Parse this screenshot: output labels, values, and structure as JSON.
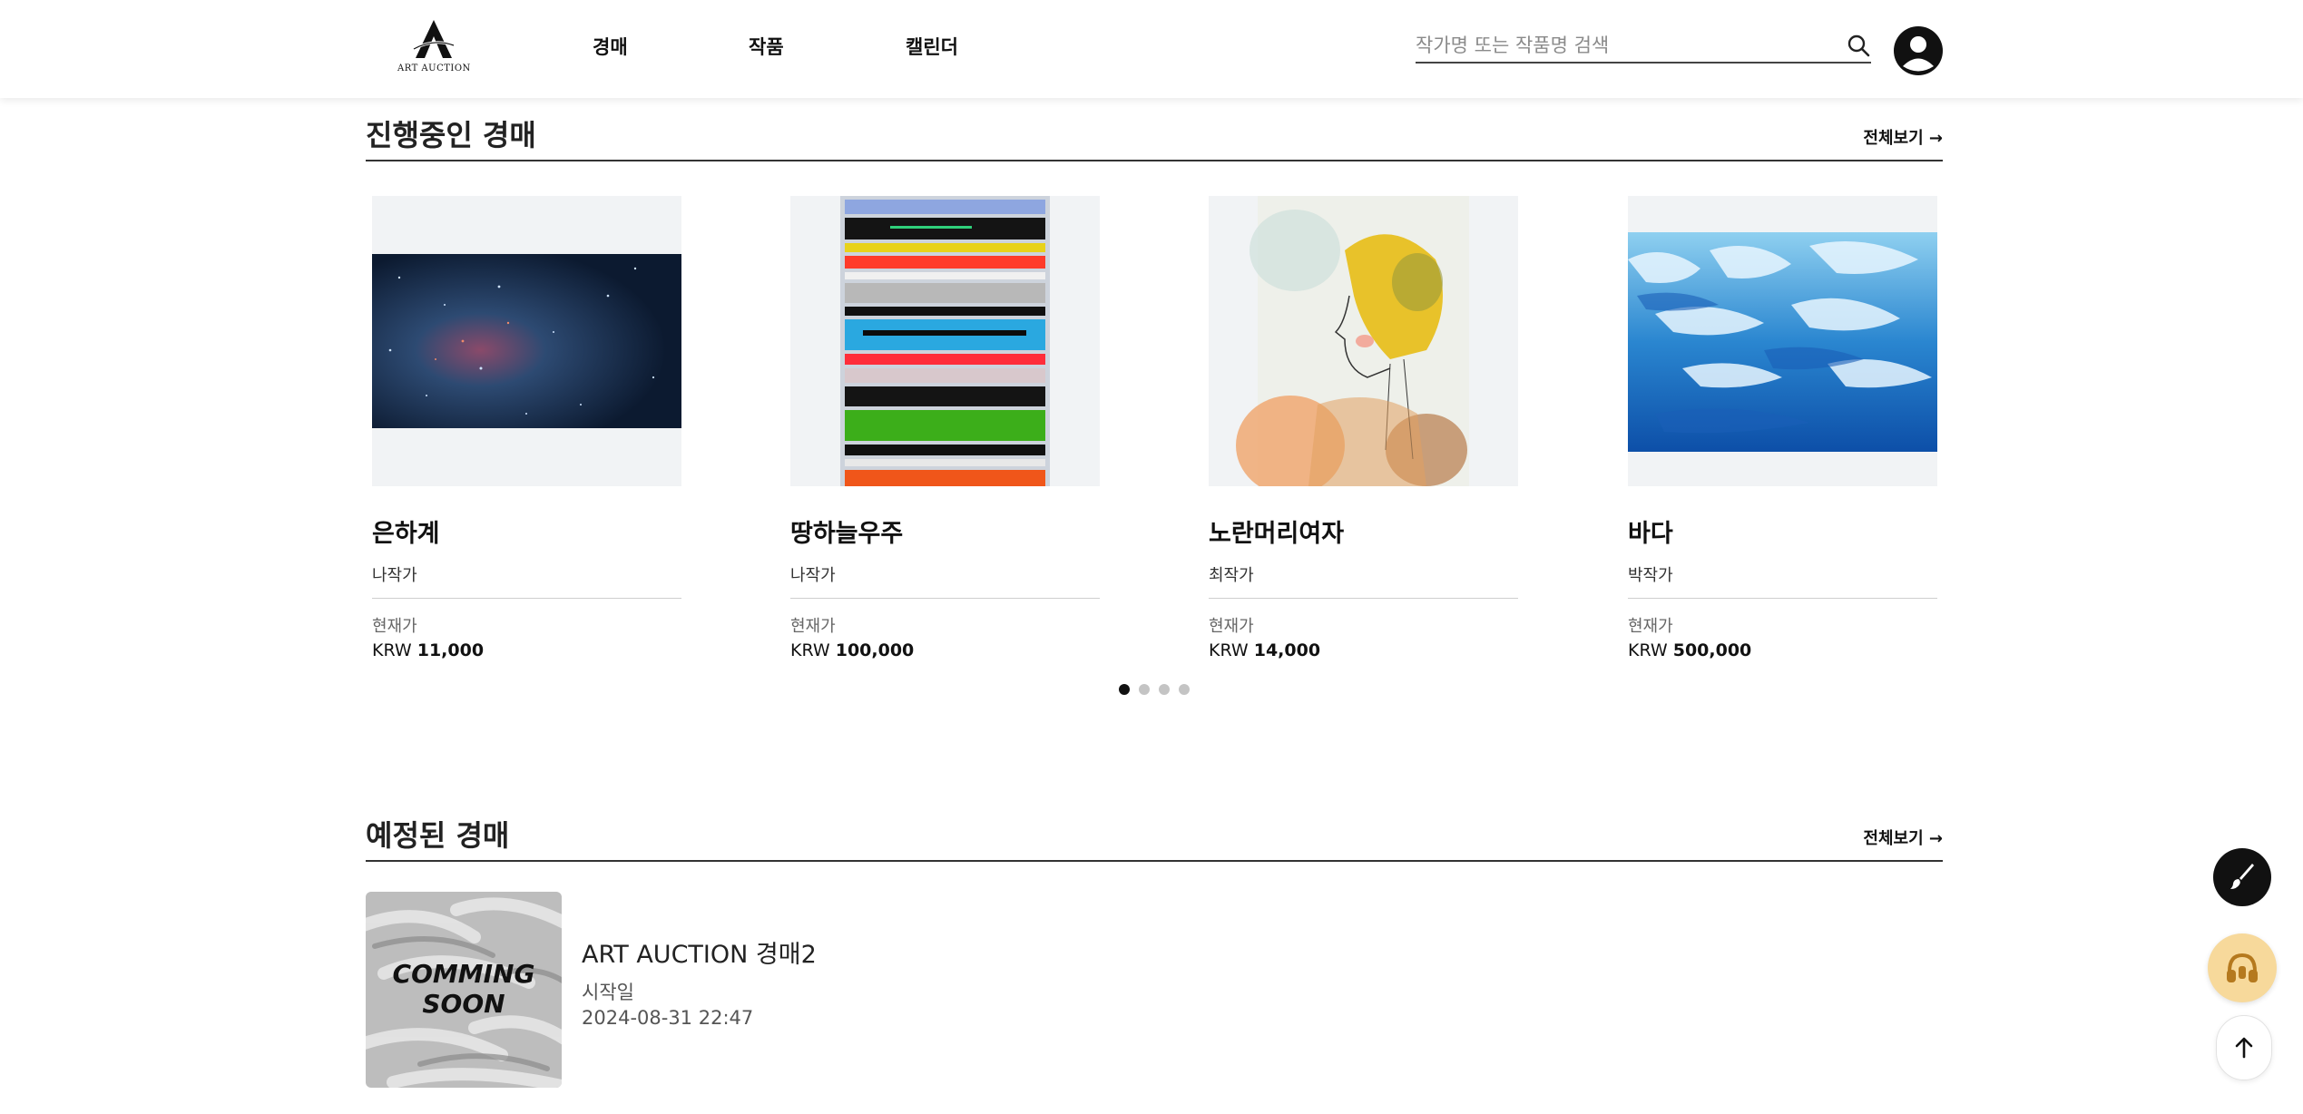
{
  "brand": {
    "logo_text": "ART AUCTION"
  },
  "nav": {
    "items": [
      "경매",
      "작품",
      "캘린더"
    ]
  },
  "search": {
    "placeholder": "작가명 또는 작품명 검색"
  },
  "ongoing": {
    "title": "진행중인 경매",
    "view_all": "전체보기 →",
    "cards": [
      {
        "title": "은하계",
        "artist": "나작가",
        "price_label": "현재가",
        "currency": "KRW",
        "price": "11,000"
      },
      {
        "title": "땅하늘우주",
        "artist": "나작가",
        "price_label": "현재가",
        "currency": "KRW",
        "price": "100,000"
      },
      {
        "title": "노란머리여자",
        "artist": "최작가",
        "price_label": "현재가",
        "currency": "KRW",
        "price": "14,000"
      },
      {
        "title": "바다",
        "artist": "박작가",
        "price_label": "현재가",
        "currency": "KRW",
        "price": "500,000"
      }
    ],
    "pagination": {
      "pages": 4,
      "active": 1
    }
  },
  "upcoming": {
    "title": "예정된 경매",
    "view_all": "전체보기 →",
    "items": [
      {
        "thumb_text": [
          "COMMING",
          "SOON"
        ],
        "title": "ART AUCTION 경매2",
        "start_label": "시작일",
        "start_date": "2024-08-31 22:47"
      }
    ]
  },
  "floating": {
    "icons": [
      "brush-icon",
      "headset-icon",
      "arrow-up-icon"
    ]
  },
  "colors": {
    "support_button": "#f7d99b",
    "support_icon": "#b5791e",
    "dark": "#111111"
  }
}
